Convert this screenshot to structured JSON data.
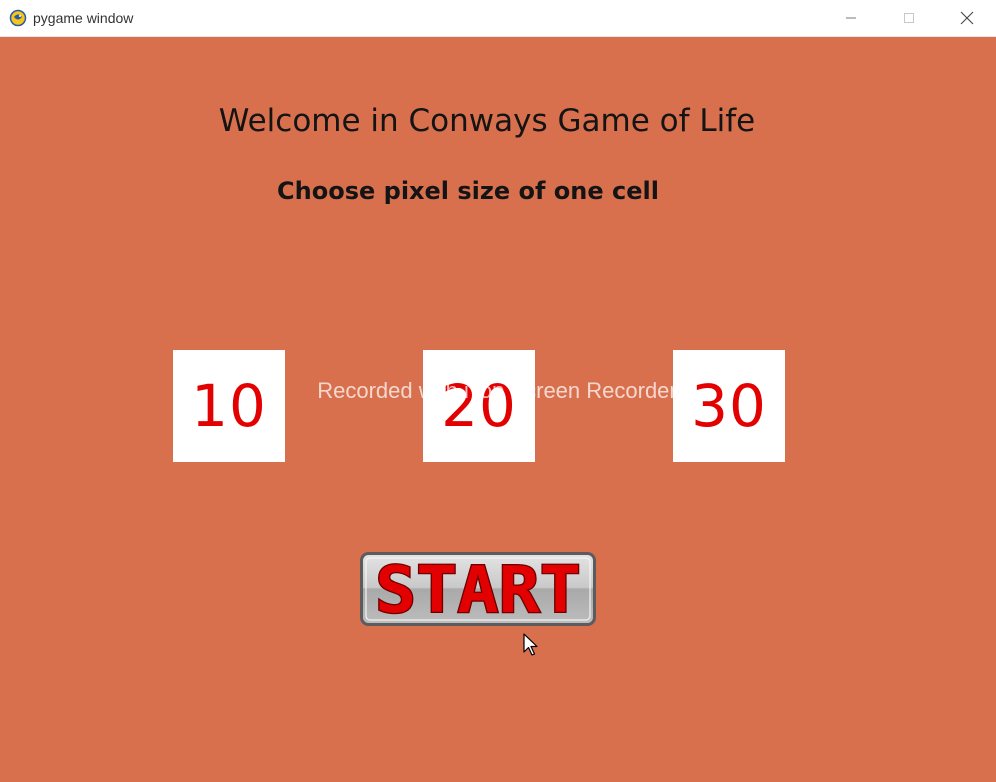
{
  "window": {
    "title": "pygame window",
    "app_icon": "pygame-snake-icon",
    "controls": {
      "minimize_icon": "minimize-icon",
      "maximize_icon": "maximize-icon",
      "close_icon": "close-icon"
    }
  },
  "menu": {
    "heading": "Welcome in Conways Game of Life",
    "subheading": "Choose pixel size of one cell",
    "background_color": "#d8704e",
    "size_options": [
      {
        "label": "10"
      },
      {
        "label": "20"
      },
      {
        "label": "30"
      }
    ],
    "option_text_color": "#e30000",
    "start_button": {
      "label": "START",
      "text_color": "#e30000"
    }
  },
  "overlay": {
    "watermark": "Recorded with iTop Screen Recorder"
  },
  "cursor": {
    "icon": "arrow-cursor-icon"
  }
}
